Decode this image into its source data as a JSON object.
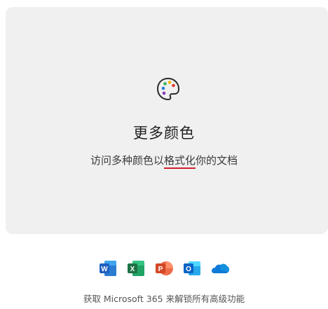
{
  "feature_card": {
    "title": "更多颜色",
    "subtitle_before": "访问多种颜色以",
    "subtitle_highlight": "格式化",
    "subtitle_after": "你的文档",
    "highlight_color": "#d21f2d",
    "icon": "palette-icon"
  },
  "apps": [
    {
      "name": "word-icon",
      "letter": "W",
      "color": "#1f5fbf"
    },
    {
      "name": "excel-icon",
      "letter": "X",
      "color": "#1e7145"
    },
    {
      "name": "powerpoint-icon",
      "letter": "P",
      "color": "#d24726"
    },
    {
      "name": "outlook-icon",
      "letter": "O",
      "color": "#0a64c8"
    },
    {
      "name": "onedrive-icon",
      "letter": "",
      "color": "#0f7ad8"
    }
  ],
  "footer": {
    "text": "获取 Microsoft 365 来解锁所有高级功能"
  }
}
